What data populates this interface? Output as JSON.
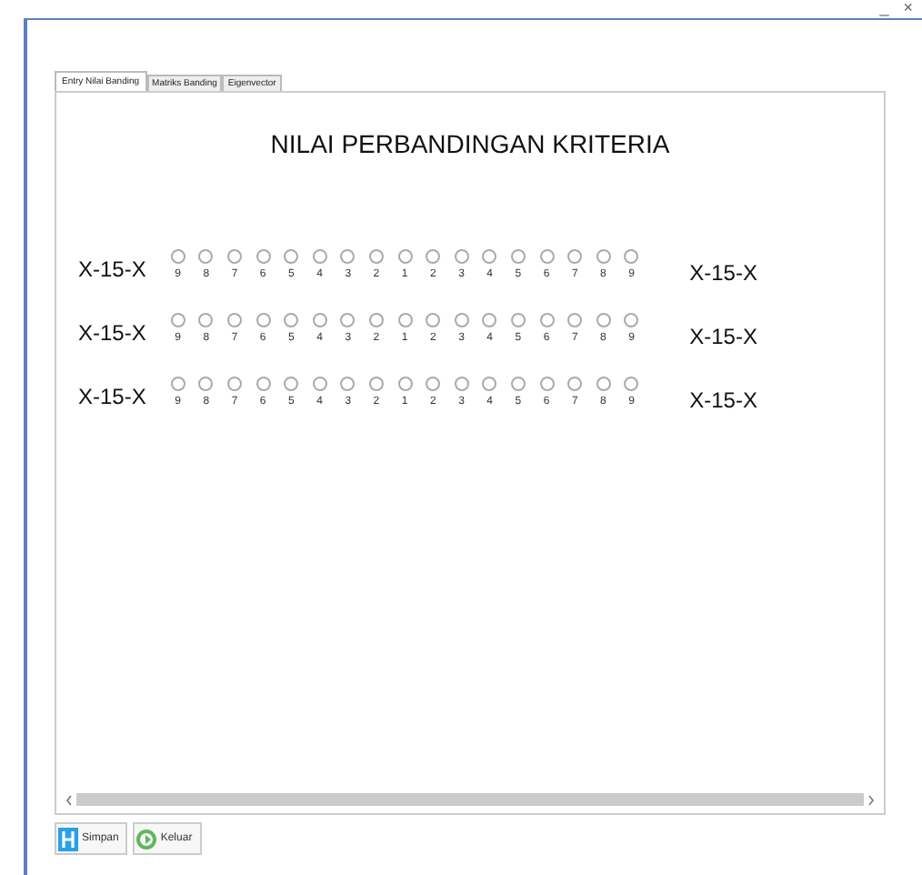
{
  "window": {
    "controls": [
      "_",
      "×"
    ]
  },
  "tabs": [
    {
      "label": "Entry Nilai Banding",
      "selected": true
    },
    {
      "label": "Matriks Banding",
      "selected": false
    },
    {
      "label": "Eigenvector",
      "selected": false
    }
  ],
  "heading": "NILAI PERBANDINGAN KRITERIA",
  "rows": [
    {
      "left": "X-15-X",
      "right": "X-15-X",
      "options": [
        {
          "label": "9",
          "selected": false
        },
        {
          "label": "8",
          "selected": false
        },
        {
          "label": "7",
          "selected": false
        },
        {
          "label": "6",
          "selected": false
        },
        {
          "label": "5",
          "selected": false
        },
        {
          "label": "4",
          "selected": false
        },
        {
          "label": "3",
          "selected": false
        },
        {
          "label": "2",
          "selected": false
        },
        {
          "label": "1",
          "selected": false
        },
        {
          "label": "2",
          "selected": false
        },
        {
          "label": "3",
          "selected": false
        },
        {
          "label": "4",
          "selected": false
        },
        {
          "label": "5",
          "selected": false
        },
        {
          "label": "6",
          "selected": false
        },
        {
          "label": "7",
          "selected": false
        },
        {
          "label": "8",
          "selected": false
        },
        {
          "label": "9",
          "selected": false
        }
      ]
    },
    {
      "left": "X-15-X",
      "right": "X-15-X",
      "options": [
        {
          "label": "9",
          "selected": false
        },
        {
          "label": "8",
          "selected": false
        },
        {
          "label": "7",
          "selected": false
        },
        {
          "label": "6",
          "selected": false
        },
        {
          "label": "5",
          "selected": false
        },
        {
          "label": "4",
          "selected": false
        },
        {
          "label": "3",
          "selected": false
        },
        {
          "label": "2",
          "selected": false
        },
        {
          "label": "1",
          "selected": false
        },
        {
          "label": "2",
          "selected": false
        },
        {
          "label": "3",
          "selected": false
        },
        {
          "label": "4",
          "selected": false
        },
        {
          "label": "5",
          "selected": false
        },
        {
          "label": "6",
          "selected": false
        },
        {
          "label": "7",
          "selected": false
        },
        {
          "label": "8",
          "selected": false
        },
        {
          "label": "9",
          "selected": false
        }
      ]
    },
    {
      "left": "X-15-X",
      "right": "X-15-X",
      "options": [
        {
          "label": "9",
          "selected": false
        },
        {
          "label": "8",
          "selected": false
        },
        {
          "label": "7",
          "selected": false
        },
        {
          "label": "6",
          "selected": false
        },
        {
          "label": "5",
          "selected": false
        },
        {
          "label": "4",
          "selected": false
        },
        {
          "label": "3",
          "selected": false
        },
        {
          "label": "2",
          "selected": false
        },
        {
          "label": "1",
          "selected": false
        },
        {
          "label": "2",
          "selected": false
        },
        {
          "label": "3",
          "selected": false
        },
        {
          "label": "4",
          "selected": false
        },
        {
          "label": "5",
          "selected": false
        },
        {
          "label": "6",
          "selected": false
        },
        {
          "label": "7",
          "selected": false
        },
        {
          "label": "8",
          "selected": false
        },
        {
          "label": "9",
          "selected": false
        }
      ]
    }
  ],
  "buttons": [
    {
      "kind": "save",
      "label": "Simpan"
    },
    {
      "kind": "exit",
      "label": "Keluar"
    }
  ]
}
